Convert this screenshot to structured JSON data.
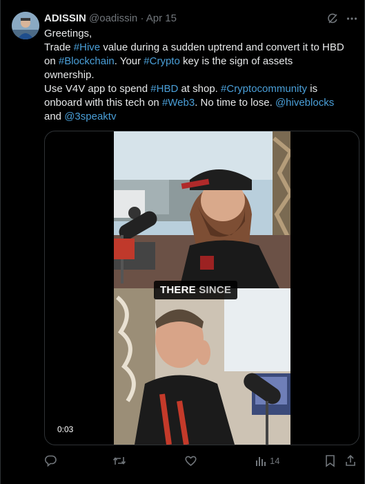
{
  "author": {
    "name": "ADISSIN",
    "handle": "@oadissin",
    "separator": "·",
    "date": "Apr 15"
  },
  "icons": {
    "grok": "grok-icon",
    "more": "more-icon",
    "reply": "reply-icon",
    "retweet": "retweet-icon",
    "like": "like-icon",
    "views": "views-icon",
    "bookmark": "bookmark-icon",
    "share": "share-icon"
  },
  "tweet": {
    "l1": "Greetings,",
    "l2_a": "Trade ",
    "l2_hive": "#Hive",
    "l2_b": " value during a sudden uptrend and convert it to HBD",
    "l3_a": "on ",
    "l3_blockchain": "#Blockchain",
    "l3_b": ". Your ",
    "l3_crypto": "#Crypto",
    "l3_c": " key is the sign of assets",
    "l4": "ownership.",
    "l5_a": "Use V4V app to spend ",
    "l5_hbd": "#HBD",
    "l5_b": " at shop. ",
    "l5_cc": "#Cryptocommunity",
    "l5_c": " is",
    "l6_a": "onboard with this tech on ",
    "l6_web3": "#Web3",
    "l6_b": ". No time to lose. ",
    "l6_hiveblocks": "@hiveblocks",
    "l7_a": "and ",
    "l7_3speak": "@3speaktv"
  },
  "media": {
    "caption_a": "THERE",
    "caption_b": " SINCE",
    "time": "0:03"
  },
  "stats": {
    "views": "14"
  },
  "colors": {
    "background": "#000000",
    "text": "#e7e9ea",
    "muted": "#71767b",
    "link": "#4a9fd8",
    "border": "#2f3336"
  }
}
